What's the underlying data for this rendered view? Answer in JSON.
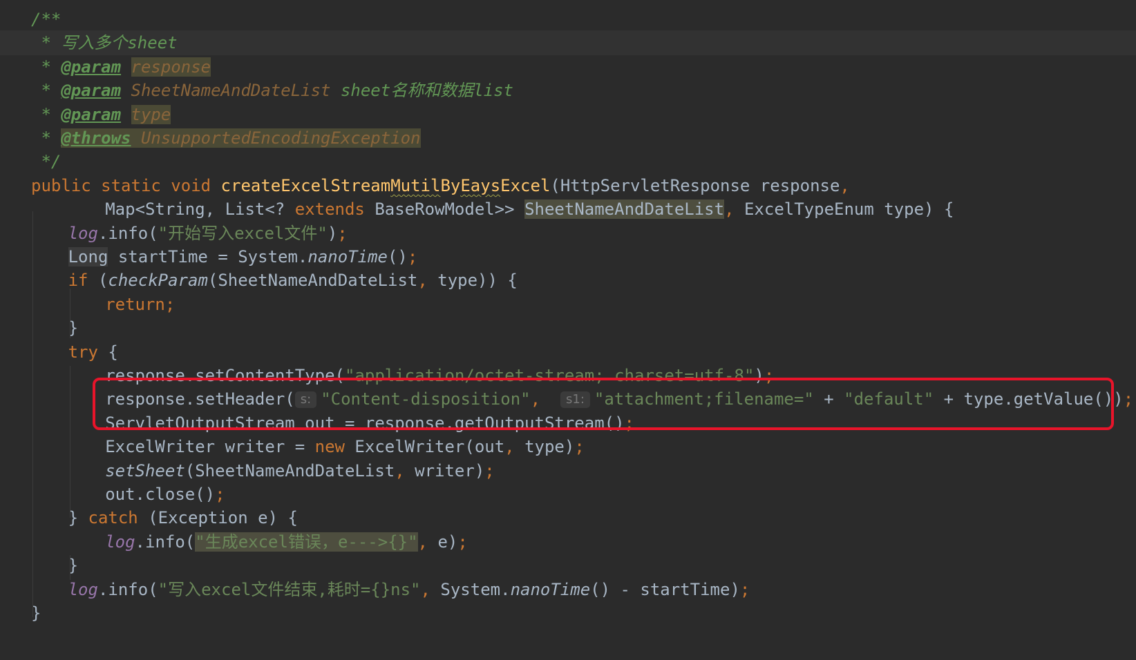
{
  "editor": {
    "language": "java",
    "theme_colors": {
      "background": "#2b2b2b",
      "default_text": "#a9b7c6",
      "keyword": "#cc7832",
      "string": "#6a8759",
      "javadoc": "#629755",
      "method_declaration": "#ffc66d",
      "static_field": "#9876aa",
      "highlight_box": "#e8142a"
    },
    "annotation": "red-rectangle-around-setContentType-and-setHeader-lines",
    "lines": [
      {
        "tokens": [
          {
            "t": "/**",
            "c": "comment"
          }
        ]
      },
      {
        "current": true,
        "tokens": [
          {
            "t": " * 写入多个sheet",
            "c": "comment"
          }
        ]
      },
      {
        "tokens": [
          {
            "t": " * ",
            "c": "comment"
          },
          {
            "t": "@param",
            "c": "comment-tag"
          },
          {
            "t": " ",
            "c": "comment"
          },
          {
            "t": "response",
            "c": "comment-param hl-unused"
          }
        ]
      },
      {
        "tokens": [
          {
            "t": " * ",
            "c": "comment"
          },
          {
            "t": "@param",
            "c": "comment-tag"
          },
          {
            "t": " ",
            "c": "comment"
          },
          {
            "t": "SheetNameAndDateList",
            "c": "comment-param"
          },
          {
            "t": " sheet名称和数据list",
            "c": "comment"
          }
        ]
      },
      {
        "tokens": [
          {
            "t": " * ",
            "c": "comment"
          },
          {
            "t": "@param",
            "c": "comment-tag"
          },
          {
            "t": " ",
            "c": "comment"
          },
          {
            "t": "type",
            "c": "comment-param hl-unused"
          }
        ]
      },
      {
        "tokens": [
          {
            "t": " * ",
            "c": "comment"
          },
          {
            "t": "@throws",
            "c": "comment-tag hl-unused"
          },
          {
            "t": " ",
            "c": "comment hl-unused"
          },
          {
            "t": "UnsupportedEncodingException",
            "c": "comment-ref hl-unused"
          }
        ]
      },
      {
        "tokens": [
          {
            "t": " */",
            "c": "comment"
          }
        ]
      },
      {
        "tokens": [
          {
            "t": "public static void ",
            "c": "keyword"
          },
          {
            "t": "createExcelStream",
            "c": "method-decl"
          },
          {
            "t": "Mutil",
            "c": "method-decl squiggle"
          },
          {
            "t": "By",
            "c": "method-decl"
          },
          {
            "t": "Eays",
            "c": "method-decl squiggle"
          },
          {
            "t": "Excel",
            "c": "method-decl"
          },
          {
            "t": "(HttpServletResponse response",
            "c": ""
          },
          {
            "t": ",",
            "c": "punct"
          }
        ]
      },
      {
        "indent": 8,
        "tokens": [
          {
            "t": "Map<String, List<? ",
            "c": ""
          },
          {
            "t": "extends",
            "c": "keyword"
          },
          {
            "t": " BaseRowModel>> ",
            "c": ""
          },
          {
            "t": "SheetNameAndDateList",
            "c": "hl-decl"
          },
          {
            "t": ", ",
            "c": "punct"
          },
          {
            "t": "ExcelTypeEnum type) {",
            "c": ""
          }
        ]
      },
      {
        "indent": 4,
        "tokens": [
          {
            "t": "log",
            "c": "static-field"
          },
          {
            "t": ".info(",
            "c": ""
          },
          {
            "t": "\"开始写入excel文件\"",
            "c": "string"
          },
          {
            "t": ")",
            "c": ""
          },
          {
            "t": ";",
            "c": "punct"
          }
        ]
      },
      {
        "indent": 4,
        "tokens": [
          {
            "t": "Long",
            "c": "hl-warn"
          },
          {
            "t": " startTime = System.",
            "c": ""
          },
          {
            "t": "nanoTime",
            "c": "italic-method"
          },
          {
            "t": "()",
            "c": ""
          },
          {
            "t": ";",
            "c": "punct"
          }
        ]
      },
      {
        "indent": 4,
        "tokens": [
          {
            "t": "if",
            "c": "keyword"
          },
          {
            "t": " (",
            "c": ""
          },
          {
            "t": "checkParam",
            "c": "italic-method"
          },
          {
            "t": "(SheetNameAndDateList",
            "c": ""
          },
          {
            "t": ", ",
            "c": "punct"
          },
          {
            "t": "type)) {",
            "c": ""
          }
        ]
      },
      {
        "indent": 8,
        "tokens": [
          {
            "t": "return;",
            "c": "keyword"
          }
        ]
      },
      {
        "indent": 4,
        "tokens": [
          {
            "t": "}",
            "c": ""
          }
        ]
      },
      {
        "indent": 4,
        "tokens": [
          {
            "t": "try",
            "c": "keyword"
          },
          {
            "t": " {",
            "c": ""
          }
        ]
      },
      {
        "indent": 8,
        "tokens": [
          {
            "t": "response.setContentType(",
            "c": ""
          },
          {
            "t": "\"application/octet-stream; charset=utf-8\"",
            "c": "string"
          },
          {
            "t": ")",
            "c": ""
          },
          {
            "t": ";",
            "c": "punct"
          }
        ]
      },
      {
        "indent": 8,
        "tokens": [
          {
            "t": "response.setHeader(",
            "c": ""
          },
          {
            "t": "s:",
            "c": "hint"
          },
          {
            "t": "\"Content-disposition\"",
            "c": "string"
          },
          {
            "t": ",  ",
            "c": "punct"
          },
          {
            "t": "s1:",
            "c": "hint"
          },
          {
            "t": "\"attachment;filename=\"",
            "c": "string"
          },
          {
            "t": " + ",
            "c": ""
          },
          {
            "t": "\"default\"",
            "c": "string"
          },
          {
            "t": " + type.getValue())",
            "c": ""
          },
          {
            "t": ";",
            "c": "punct"
          }
        ]
      },
      {
        "indent": 8,
        "tokens": [
          {
            "t": "ServletOutputStream out = response.getOutputStream()",
            "c": ""
          },
          {
            "t": ";",
            "c": "punct"
          }
        ]
      },
      {
        "indent": 8,
        "tokens": [
          {
            "t": "ExcelWriter writer = ",
            "c": ""
          },
          {
            "t": "new",
            "c": "keyword"
          },
          {
            "t": " ExcelWriter(out",
            "c": ""
          },
          {
            "t": ", ",
            "c": "punct"
          },
          {
            "t": "type)",
            "c": ""
          },
          {
            "t": ";",
            "c": "punct"
          }
        ]
      },
      {
        "indent": 8,
        "tokens": [
          {
            "t": "setSheet",
            "c": "italic-method"
          },
          {
            "t": "(SheetNameAndDateList",
            "c": ""
          },
          {
            "t": ", ",
            "c": "punct"
          },
          {
            "t": "writer)",
            "c": ""
          },
          {
            "t": ";",
            "c": "punct"
          }
        ]
      },
      {
        "indent": 8,
        "tokens": [
          {
            "t": "out.close()",
            "c": ""
          },
          {
            "t": ";",
            "c": "punct"
          }
        ]
      },
      {
        "indent": 4,
        "tokens": [
          {
            "t": "} ",
            "c": ""
          },
          {
            "t": "catch",
            "c": "keyword"
          },
          {
            "t": " (Exception e) {",
            "c": ""
          }
        ]
      },
      {
        "indent": 8,
        "tokens": [
          {
            "t": "log",
            "c": "static-field"
          },
          {
            "t": ".info(",
            "c": ""
          },
          {
            "t": "\"生成excel错误，e--->{}\"",
            "c": "string hl-decl"
          },
          {
            "t": ", ",
            "c": "punct"
          },
          {
            "t": "e)",
            "c": ""
          },
          {
            "t": ";",
            "c": "punct"
          }
        ]
      },
      {
        "indent": 4,
        "tokens": [
          {
            "t": "}",
            "c": ""
          }
        ]
      },
      {
        "indent": 4,
        "tokens": [
          {
            "t": "log",
            "c": "static-field"
          },
          {
            "t": ".info(",
            "c": ""
          },
          {
            "t": "\"写入excel文件结束,耗时={}ns\"",
            "c": "string"
          },
          {
            "t": ", ",
            "c": "punct"
          },
          {
            "t": "System.",
            "c": ""
          },
          {
            "t": "nanoTime",
            "c": "italic-method"
          },
          {
            "t": "() - startTime)",
            "c": ""
          },
          {
            "t": ";",
            "c": "punct"
          }
        ]
      },
      {
        "tokens": [
          {
            "t": "}",
            "c": ""
          }
        ]
      }
    ]
  }
}
